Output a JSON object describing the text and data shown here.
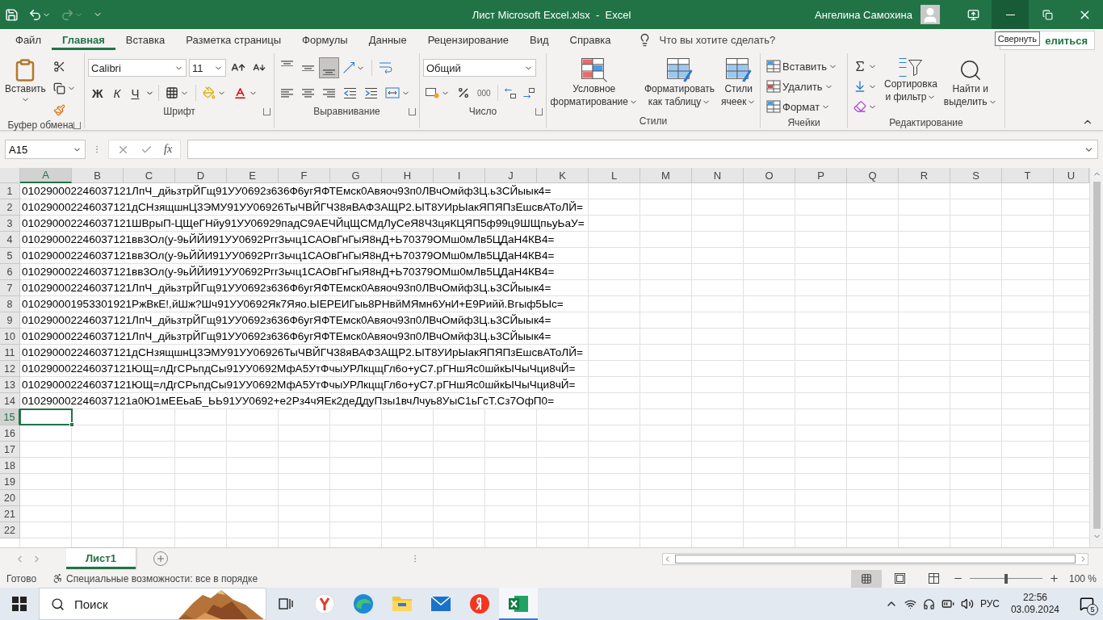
{
  "title_bar": {
    "title": "Лист Microsoft Excel.xlsx  -  Excel",
    "user_name": "Ангелина Самохина"
  },
  "tooltip": "Свернуть",
  "menu_tabs": [
    {
      "label": "Файл",
      "selected": false
    },
    {
      "label": "Главная",
      "selected": true
    },
    {
      "label": "Вставка",
      "selected": false
    },
    {
      "label": "Разметка страницы",
      "selected": false
    },
    {
      "label": "Формулы",
      "selected": false
    },
    {
      "label": "Данные",
      "selected": false
    },
    {
      "label": "Рецензирование",
      "selected": false
    },
    {
      "label": "Вид",
      "selected": false
    },
    {
      "label": "Справка",
      "selected": false
    }
  ],
  "tell_me": {
    "placeholder": "Что вы хотите сделать?"
  },
  "share_button": "елиться",
  "ribbon": {
    "clipboard": {
      "paste": "Вставить",
      "group": "Буфер обмена"
    },
    "font": {
      "name": "Calibri",
      "size": "11",
      "bold": "Ж",
      "italic": "К",
      "underline": "Ч",
      "group": "Шрифт"
    },
    "alignment": {
      "vertical": [
        {
          "selected": false
        },
        {
          "selected": false
        },
        {
          "selected": true
        }
      ],
      "group": "Выравнивание"
    },
    "number": {
      "format": "Общий",
      "thousands": "000",
      "group": "Число"
    },
    "styles": {
      "buttons": [
        {
          "lines": [
            "Условное",
            "форматирование"
          ]
        },
        {
          "lines": [
            "Форматировать",
            "как таблицу"
          ]
        },
        {
          "lines": [
            "Стили",
            "ячеек"
          ]
        }
      ],
      "group": "Стили"
    },
    "cells": {
      "buttons": [
        "Вставить",
        "Удалить",
        "Формат"
      ],
      "group": "Ячейки"
    },
    "editing": {
      "buttons": [
        {
          "lines": [
            "Сортировка",
            "и фильтр"
          ]
        },
        {
          "lines": [
            "Найти и",
            "выделить"
          ]
        }
      ],
      "group": "Редактирование"
    }
  },
  "formula_bar": {
    "name_box": "A15",
    "function_label": "fx"
  },
  "sheet": {
    "columns": [
      {
        "label": "A",
        "selected": true
      },
      {
        "label": "B",
        "selected": false
      },
      {
        "label": "C",
        "selected": false
      },
      {
        "label": "D",
        "selected": false
      },
      {
        "label": "E",
        "selected": false
      },
      {
        "label": "F",
        "selected": false
      },
      {
        "label": "G",
        "selected": false
      },
      {
        "label": "H",
        "selected": false
      },
      {
        "label": "I",
        "selected": false
      },
      {
        "label": "J",
        "selected": false
      },
      {
        "label": "K",
        "selected": false
      },
      {
        "label": "L",
        "selected": false
      },
      {
        "label": "M",
        "selected": false
      },
      {
        "label": "N",
        "selected": false
      },
      {
        "label": "O",
        "selected": false
      },
      {
        "label": "P",
        "selected": false
      },
      {
        "label": "Q",
        "selected": false
      },
      {
        "label": "R",
        "selected": false
      },
      {
        "label": "S",
        "selected": false
      },
      {
        "label": "T",
        "selected": false
      },
      {
        "label": "U",
        "selected": false
      }
    ],
    "rows": [
      {
        "number": "1",
        "selected": false,
        "value": "010290002246037121ЛпЧ_дйьзтрЙГщ91УУ0692з636Ф6угЯФТЕмск0Авяоч93п0ЛВчОмйф3Ц.ь3СЙыык4="
      },
      {
        "number": "2",
        "selected": false,
        "value": "010290002246037121дСНзящшнЦ3ЭМУ91УУ06926ТыЧВЙГЧ38яВАФЗАЩР2.ЫТ8УИрЫакЯПЯПзЕшсвАТоЛЙ="
      },
      {
        "number": "3",
        "selected": false,
        "value": "010290002246037121ШВрыП-ЦЩеГНйу91УУ06929падС9АЕЧЙцЩСМдЛуСеЯ8Ч3цяКЦЯП5ф99ц9ШЩпьуЬаУ="
      },
      {
        "number": "4",
        "selected": false,
        "value": "010290002246037121вв3Ол(у-9ьЙЙИ91УУ0692Ргг3ьчц1САОвГнГыЯ8нД+Ь70379ОМш0мЛв5ЦДаН4КВ4="
      },
      {
        "number": "5",
        "selected": false,
        "value": "010290002246037121вв3Ол(у-9ьЙЙИ91УУ0692Ргг3ьчц1САОвГнГыЯ8нД+Ь70379ОМш0мЛв5ЦДаН4КВ4="
      },
      {
        "number": "6",
        "selected": false,
        "value": "010290002246037121вв3Ол(у-9ьЙЙИ91УУ0692Ргг3ьчц1САОвГнГыЯ8нД+Ь70379ОМш0мЛв5ЦДаН4КВ4="
      },
      {
        "number": "7",
        "selected": false,
        "value": "010290002246037121ЛпЧ_дйьзтрЙГщ91УУ0692з636Ф6угЯФТЕмск0Авяоч93п0ЛВчОмйф3Ц.ь3СЙыык4="
      },
      {
        "number": "8",
        "selected": false,
        "value": "010290001953301921РжВкЕ!,йШж?Шч91УУ0692Як7Яяо.ЫЕРЕИГыь8РНвйМЯмн6УнИ+Е9Рийй.Вгыф5Ыс="
      },
      {
        "number": "9",
        "selected": false,
        "value": "010290002246037121ЛпЧ_дйьзтрЙГщ91УУ0692з636Ф6угЯФТЕмск0Авяоч93п0ЛВчОмйф3Ц.ь3СЙыык4="
      },
      {
        "number": "10",
        "selected": false,
        "value": "010290002246037121ЛпЧ_дйьзтрЙГщ91УУ0692з636Ф6угЯФТЕмск0Авяоч93п0ЛВчОмйф3Ц.ь3СЙыык4="
      },
      {
        "number": "11",
        "selected": false,
        "value": "010290002246037121дСНзящшнЦ3ЭМУ91УУ06926ТыЧВЙГЧ38яВАФЗАЩР2.ЫТ8УИрЫакЯПЯПзЕшсвАТоЛЙ="
      },
      {
        "number": "12",
        "selected": false,
        "value": "010290002246037121ЮЩ=лДгСРьпдСы91УУ0692МфА5УтФчыУРЛкцщГл6о+уС7.рГНшЯс0шйкЫЧыЧци8чЙ="
      },
      {
        "number": "13",
        "selected": false,
        "value": "010290002246037121ЮЩ=лДгСРьпдСы91УУ0692МфА5УтФчыУРЛкцщГл6о+уС7.рГНшЯс0шйкЫЧыЧци8чЙ="
      },
      {
        "number": "14",
        "selected": false,
        "value": "010290002246037121а0Ю1мЕЕьаБ_ЬЬ91УУ0692+е2Рз4чЯЕк2деДдуПзы1вчЛчуь8УыС1ьГсТ.Сз7ОфП0="
      },
      {
        "number": "15",
        "selected": true
      },
      {
        "number": "16",
        "selected": false
      },
      {
        "number": "17",
        "selected": false
      },
      {
        "number": "18",
        "selected": false
      },
      {
        "number": "19",
        "selected": false
      },
      {
        "number": "20",
        "selected": false
      },
      {
        "number": "21",
        "selected": false
      },
      {
        "number": "22",
        "selected": false
      }
    ]
  },
  "sheet_tabs": [
    {
      "label": "Лист1",
      "selected": true
    }
  ],
  "status_bar": {
    "ready": "Готово",
    "accessibility": "Специальные возможности: все в порядке",
    "zoom": {
      "level": 0.5,
      "reading": "100 %"
    }
  },
  "taskbar": {
    "search_placeholder": "Поиск",
    "apps": [
      {
        "kind": "taskview",
        "active": false
      },
      {
        "kind": "yandex-browser",
        "active": false
      },
      {
        "kind": "edge",
        "active": false
      },
      {
        "kind": "folder",
        "active": false
      },
      {
        "kind": "mail",
        "active": false
      },
      {
        "kind": "yandex",
        "active": false
      },
      {
        "kind": "excel",
        "active": true
      }
    ],
    "language": "РУС",
    "time": "22:56",
    "date": "03.09.2024",
    "notifications": "5"
  }
}
